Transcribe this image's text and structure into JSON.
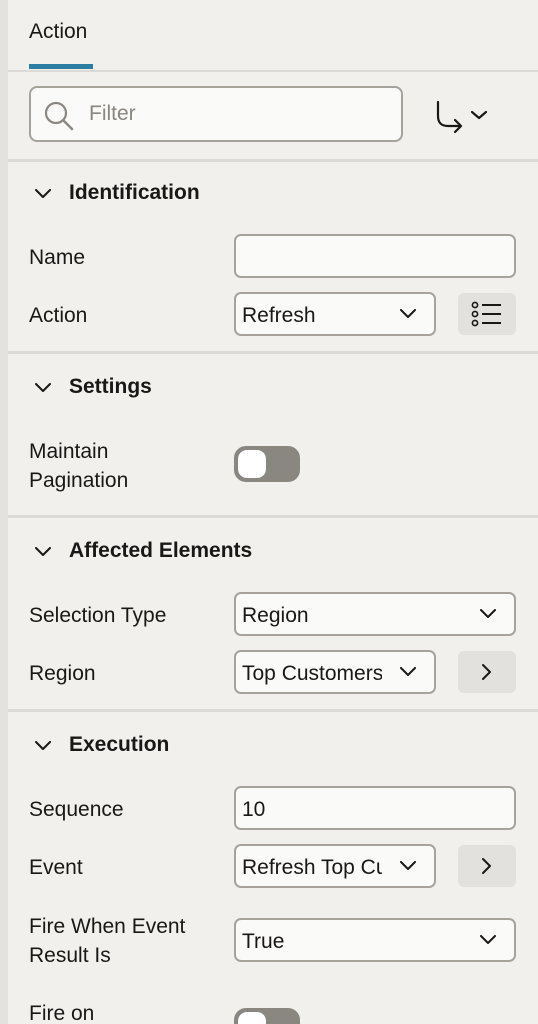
{
  "tabs": [
    {
      "label": "Action",
      "active": true
    }
  ],
  "filter": {
    "placeholder": "Filter",
    "value": ""
  },
  "icons": {
    "search": "search-icon",
    "goto": "go-to-arrow-icon",
    "chevron": "chevron-down-icon",
    "list": "list-icon",
    "next": "chevron-right-icon"
  },
  "colors": {
    "accent": "#2b7ea1",
    "background": "#f1f0ed",
    "field_border": "#a6a29c",
    "toggle_off": "#8a8680"
  },
  "sections": {
    "identification": {
      "title": "Identification",
      "name_label": "Name",
      "name_value": "",
      "action_label": "Action",
      "action_value": "Refresh"
    },
    "settings": {
      "title": "Settings",
      "pagination_label_1": "Maintain",
      "pagination_label_2": "Pagination",
      "pagination_on": false
    },
    "affected": {
      "title": "Affected Elements",
      "selection_type_label": "Selection Type",
      "selection_type_value": "Region",
      "region_label": "Region",
      "region_value": "Top Customers"
    },
    "execution": {
      "title": "Execution",
      "sequence_label": "Sequence",
      "sequence_value": "10",
      "event_label": "Event",
      "event_value": "Refresh Top Customers",
      "fire_when_label_1": "Fire When Event",
      "fire_when_label_2": "Result Is",
      "fire_when_value": "True",
      "fire_on_label": "Fire on"
    }
  }
}
